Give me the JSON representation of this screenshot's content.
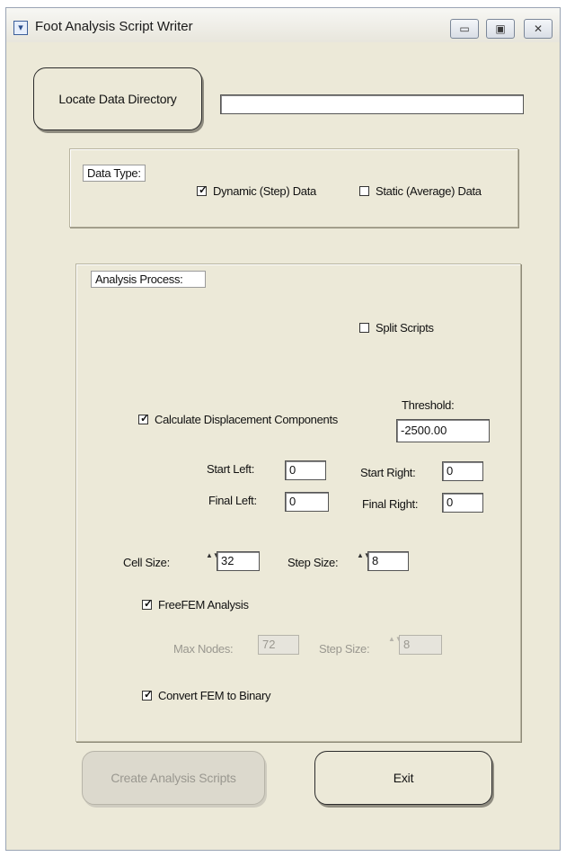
{
  "window": {
    "title": "Foot Analysis Script Writer",
    "controls": {
      "minimize": "▭",
      "maximize": "▣",
      "close": "✕"
    }
  },
  "directory": {
    "locate_label": "Locate Data Directory",
    "path_value": ""
  },
  "data_type": {
    "label": "Data Type:",
    "dynamic": {
      "label": "Dynamic (Step) Data",
      "checked": true
    },
    "static": {
      "label": "Static (Average) Data",
      "checked": false
    }
  },
  "analysis": {
    "label": "Analysis Process:",
    "split_scripts": {
      "label": "Split Scripts",
      "checked": false
    },
    "displacement": {
      "label": "Calculate Displacement Components",
      "checked": true
    },
    "threshold": {
      "label": "Threshold:",
      "value": "-2500.00"
    },
    "start_left": {
      "label": "Start Left:",
      "value": "0"
    },
    "final_left": {
      "label": "Final Left:",
      "value": "0"
    },
    "start_right": {
      "label": "Start Right:",
      "value": "0"
    },
    "final_right": {
      "label": "Final Right:",
      "value": "0"
    },
    "cell_size": {
      "label": "Cell Size:",
      "value": "32"
    },
    "step_size": {
      "label": "Step Size:",
      "value": "8"
    },
    "freefem": {
      "label": "FreeFEM Analysis",
      "checked": true
    },
    "max_nodes": {
      "label": "Max Nodes:",
      "value": "72"
    },
    "fem_step_size": {
      "label": "Step Size:",
      "value": "8"
    },
    "convert_binary": {
      "label": "Convert FEM to Binary",
      "checked": true
    }
  },
  "actions": {
    "create_label": "Create Analysis Scripts",
    "exit_label": "Exit"
  },
  "glyphs": {
    "check": "✓",
    "spin": "▲▼"
  }
}
